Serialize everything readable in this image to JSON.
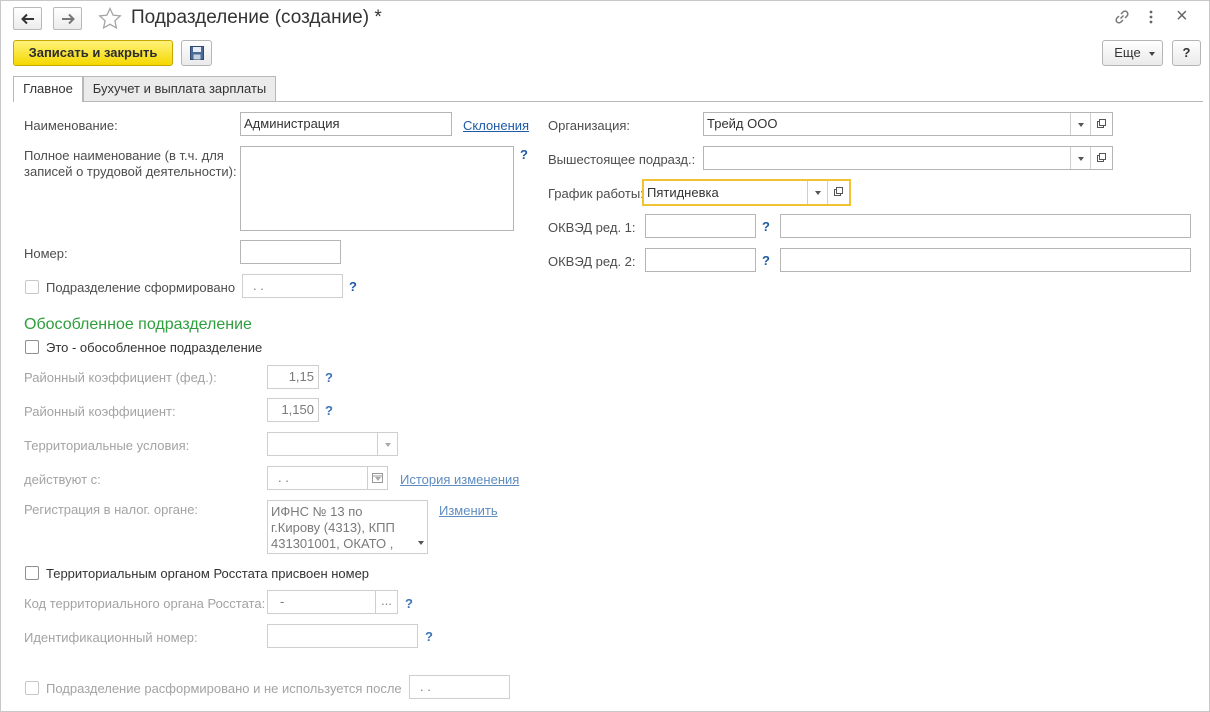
{
  "window": {
    "title": "Подразделение (создание) *",
    "back_icon": "arrow-left-icon",
    "forward_icon": "arrow-right-icon",
    "favorite_icon": "star-icon",
    "link_icon": "link-icon",
    "menu_icon": "vertical-dots-icon",
    "close_label": "×"
  },
  "toolbar": {
    "save_close_label": "Записать и закрыть",
    "save_icon": "floppy-disk-icon",
    "more_label": "Еще",
    "help_label": "?"
  },
  "tabs": [
    {
      "label": "Главное",
      "active": true
    },
    {
      "label": "Бухучет и выплата зарплаты",
      "active": false
    }
  ],
  "left": {
    "name_label": "Наименование:",
    "name_value": "Администрация",
    "declensions_link": "Склонения",
    "fullname_label_line1": "Полное наименование (в т.ч. для",
    "fullname_label_line2": "записей о трудовой деятельности):",
    "fullname_value": "",
    "number_label": "Номер:",
    "number_value": "",
    "formed_label": "Подразделение сформировано",
    "formed_date": " .  .",
    "help_mark": "?"
  },
  "separate_section": {
    "title": "Обособленное подразделение",
    "is_separate_label": "Это - обособленное подразделение",
    "coef_fed_label": "Районный коэффициент (фед.):",
    "coef_fed_value": "1,15",
    "coef_label": "Районный коэффициент:",
    "coef_value": "1,150",
    "territorial_label": "Территориальные условия:",
    "territorial_value": "",
    "valid_from_label": "действуют с:",
    "valid_from_value": " .  .",
    "history_link": "История изменения",
    "tax_reg_label": "Регистрация в налог. органе:",
    "tax_reg_line1": "ИФНС № 13 по",
    "tax_reg_line2": "г.Кирову (4313), КПП",
    "tax_reg_line3": "431301001, ОКАТО ,",
    "change_link": "Изменить",
    "rosstat_assigned_label": "Территориальным органом Росстата присвоен номер",
    "rosstat_code_label": "Код территориального органа Росстата:",
    "rosstat_code_value": "-",
    "rosstat_code_btn": "...",
    "ident_label": "Идентификационный номер:",
    "ident_value": "",
    "disbanded_label": "Подразделение расформировано и не используется после",
    "disbanded_date": " .  ."
  },
  "right": {
    "org_label": "Организация:",
    "org_value": "Трейд ООО",
    "parent_label": "Вышестоящее подразд.:",
    "parent_value": "",
    "schedule_label": "График работы:",
    "schedule_value": "Пятидневка",
    "okved1_label": "ОКВЭД ред. 1:",
    "okved2_label": "ОКВЭД ред. 2:",
    "okved_code_value": "",
    "okved_name_value": "",
    "open_icon": "open-window-icon",
    "dropdown_icon": "chevron-down-icon"
  }
}
